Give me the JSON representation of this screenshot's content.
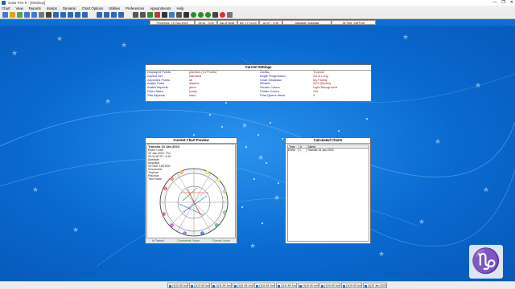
{
  "window": {
    "title": "Solar Fire 9 - [Desktop]",
    "controls": [
      "—",
      "❐",
      "✕"
    ]
  },
  "menu": [
    "Chart",
    "View",
    "Reports",
    "Interps",
    "Dynamic",
    "Chart Options",
    "Utilities",
    "Preferences",
    "Appointments",
    "Help"
  ],
  "status": {
    "date": "Persembe, 19 Oca 2023",
    "time": "09:34 - 3:00",
    "asc": "Asc 8°Ar38'",
    "mc": "MC 17°Cp13'",
    "acst": "ACST - 9:30",
    "location": "Adelaide, Australia",
    "coords": "34°S55' 138°E35'"
  },
  "settings": {
    "title": "Current Settings",
    "rows": [
      [
        "Displayed Points",
        "placidus (14 Points)",
        "Zodiac",
        "Tropical"
      ],
      [
        "Aspect Set",
        "standard",
        "Angle Progression",
        "SA in Long"
      ],
      [
        "Aspected Points",
        "all",
        "Chart Database",
        "My Family"
      ],
      [
        "Arabic Parts",
        "allparts",
        "Wheels",
        "ACS (Builtin)"
      ],
      [
        "Arabic Aspects",
        "parts",
        "Screen Colors",
        "Light Background"
      ],
      [
        "Fixed Stars",
        "brady",
        "Printer Colors",
        "Std"
      ],
      [
        "Star Aspects",
        "stars",
        "Print Queue Items",
        "0"
      ]
    ]
  },
  "preview": {
    "title": "Current Chart Preview",
    "chart_title": "Transits 19 Jan 2023",
    "info": [
      "Event Chart",
      "19 Jan 2023, Thu",
      "09:34 ACST -9:30",
      "Adelaide",
      "Australia",
      "34°S55' 138°E35'",
      "Geocentric",
      "Tropical",
      "Placidus",
      "True Node"
    ],
    "footer": [
      "Is Transit",
      "Comments: None",
      "Events: None"
    ]
  },
  "calculated": {
    "title": "Calculated Charts",
    "headers": [
      "Type",
      "#",
      "Name"
    ],
    "rows": [
      {
        "type": "Event",
        "num": "1",
        "name": "Transits 19 Jan 2023"
      }
    ]
  },
  "logo": {
    "glyph": "♑",
    "color": "#0f2a66"
  },
  "taskbar": [
    "(1)12:45 Jun 2023",
    "(1)12:45 Jun 2023",
    "(1)11:45 Jun 2023",
    "(1)11:45 Jun 2023",
    "(1)11:45 Jun 2023",
    "(1)11:45 Jun 2023",
    "(1)10:40 Jun 2023",
    "(1)10:40 Jun 2023",
    "(1)10:40 Jun 2023",
    "(1)19 Jan 2023"
  ]
}
